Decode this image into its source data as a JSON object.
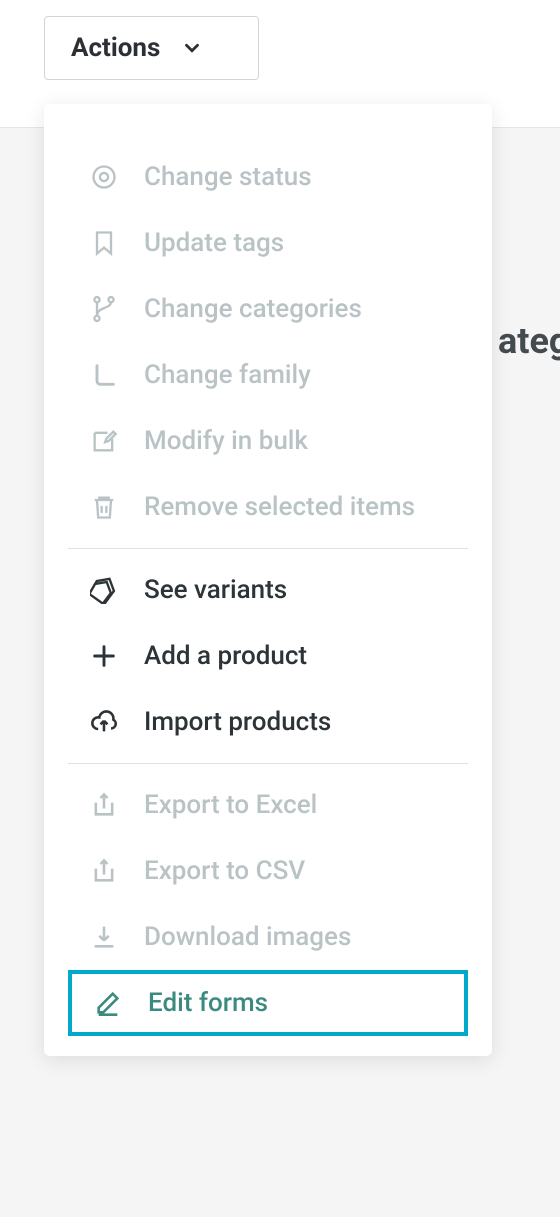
{
  "button": {
    "label": "Actions"
  },
  "menu": {
    "groups": [
      [
        {
          "icon": "eye",
          "label": "Change status",
          "disabled": true,
          "highlighted": false
        },
        {
          "icon": "bookmark",
          "label": "Update tags",
          "disabled": true,
          "highlighted": false
        },
        {
          "icon": "branch",
          "label": "Change categories",
          "disabled": true,
          "highlighted": false
        },
        {
          "icon": "corner",
          "label": "Change family",
          "disabled": true,
          "highlighted": false
        },
        {
          "icon": "edit-box",
          "label": "Modify in bulk",
          "disabled": true,
          "highlighted": false
        },
        {
          "icon": "trash",
          "label": "Remove selected items",
          "disabled": true,
          "highlighted": false
        }
      ],
      [
        {
          "icon": "tags",
          "label": "See variants",
          "disabled": false,
          "highlighted": false
        },
        {
          "icon": "plus",
          "label": "Add a product",
          "disabled": false,
          "highlighted": false
        },
        {
          "icon": "cloud-up",
          "label": "Import products",
          "disabled": false,
          "highlighted": false
        }
      ],
      [
        {
          "icon": "export",
          "label": "Export to Excel",
          "disabled": true,
          "highlighted": false
        },
        {
          "icon": "export",
          "label": "Export to CSV",
          "disabled": true,
          "highlighted": false
        },
        {
          "icon": "download",
          "label": "Download images",
          "disabled": true,
          "highlighted": false
        },
        {
          "icon": "pencil",
          "label": "Edit forms",
          "disabled": false,
          "highlighted": true
        }
      ]
    ]
  },
  "backgroundText": "ateg"
}
